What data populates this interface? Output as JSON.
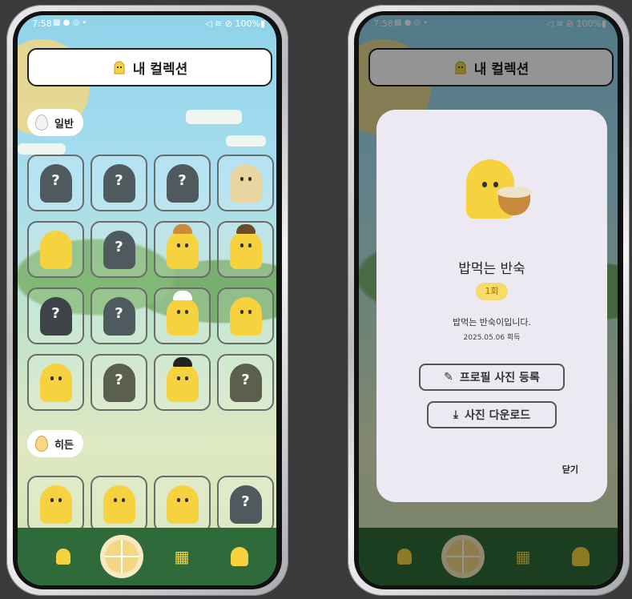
{
  "left": {
    "status": {
      "time": "7:58",
      "icons": "▩ ● ◎ •",
      "right": "◁ ≋ ⊘ 100%▮"
    },
    "header": {
      "title": "내 컬렉션"
    },
    "sections": [
      {
        "label": "일반"
      },
      {
        "label": "히든"
      }
    ],
    "grid_q": "?"
  },
  "right": {
    "status": {
      "time": "7:58",
      "icons": "▩ ● ◎ •",
      "right": "◁ ≋ ⊘ 100%▮"
    },
    "header": {
      "title": "내 컬렉션"
    },
    "modal": {
      "name": "밥먹는 반숙",
      "badge": "1회",
      "description": "밥먹는 반숙이입니다.",
      "date": "2025.05.06 획득",
      "profile_button": "프로필 사진 등록",
      "download_button": "사진 다운로드",
      "close": "닫기"
    }
  },
  "colors": {
    "ghost": "#f6d23e",
    "locked": "#4f5a5f",
    "nav": "#2f6b3a"
  }
}
